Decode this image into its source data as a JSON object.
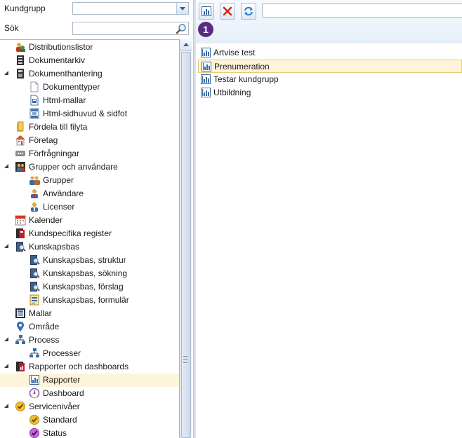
{
  "filters": {
    "kundgrupp_label": "Kundgrupp",
    "kundgrupp_value": "",
    "sok_label": "Sök",
    "sok_value": ""
  },
  "tree": [
    {
      "label": "Distributionslistor",
      "icon": "distribution-list-icon",
      "level": 0,
      "expand": false
    },
    {
      "label": "Dokumentarkiv",
      "icon": "document-archive-icon",
      "level": 0,
      "expand": false
    },
    {
      "label": "Dokumenthantering",
      "icon": "document-management-icon",
      "level": 0,
      "expand": true
    },
    {
      "label": "Dokumenttyper",
      "icon": "document-icon",
      "level": 1,
      "expand": false
    },
    {
      "label": "Html-mallar",
      "icon": "html-template-icon",
      "level": 1,
      "expand": false
    },
    {
      "label": "Html-sidhuvud & sidfot",
      "icon": "html-header-footer-icon",
      "level": 1,
      "expand": false
    },
    {
      "label": "Fördela till filyta",
      "icon": "folder-icon",
      "level": 0,
      "expand": false
    },
    {
      "label": "Företag",
      "icon": "company-icon",
      "level": 0,
      "expand": false
    },
    {
      "label": "Förfrågningar",
      "icon": "request-icon",
      "level": 0,
      "expand": false
    },
    {
      "label": "Grupper och användare",
      "icon": "groups-users-icon",
      "level": 0,
      "expand": true
    },
    {
      "label": "Grupper",
      "icon": "group-icon",
      "level": 1,
      "expand": false
    },
    {
      "label": "Användare",
      "icon": "user-icon",
      "level": 1,
      "expand": false
    },
    {
      "label": "Licenser",
      "icon": "license-user-icon",
      "level": 1,
      "expand": false
    },
    {
      "label": "Kalender",
      "icon": "calendar-icon",
      "level": 0,
      "expand": false
    },
    {
      "label": "Kundspecifika register",
      "icon": "custom-register-icon",
      "level": 0,
      "expand": false
    },
    {
      "label": "Kunskapsbas",
      "icon": "knowledge-base-icon",
      "level": 0,
      "expand": true
    },
    {
      "label": "Kunskapsbas, struktur",
      "icon": "knowledge-base-icon",
      "level": 1,
      "expand": false
    },
    {
      "label": "Kunskapsbas, sökning",
      "icon": "knowledge-base-icon",
      "level": 1,
      "expand": false
    },
    {
      "label": "Kunskapsbas, förslag",
      "icon": "knowledge-base-icon",
      "level": 1,
      "expand": false
    },
    {
      "label": "Kunskapsbas, formulär",
      "icon": "form-icon",
      "level": 1,
      "expand": false
    },
    {
      "label": "Mallar",
      "icon": "template-icon",
      "level": 0,
      "expand": false
    },
    {
      "label": "Område",
      "icon": "location-pin-icon",
      "level": 0,
      "expand": false
    },
    {
      "label": "Process",
      "icon": "process-icon",
      "level": 0,
      "expand": true
    },
    {
      "label": "Processer",
      "icon": "process-icon",
      "level": 1,
      "expand": false
    },
    {
      "label": "Rapporter och dashboards",
      "icon": "reports-icon",
      "level": 0,
      "expand": true
    },
    {
      "label": "Rapporter",
      "icon": "report-chart-icon",
      "level": 1,
      "expand": false,
      "selected": true
    },
    {
      "label": "Dashboard",
      "icon": "dashboard-icon",
      "level": 1,
      "expand": false
    },
    {
      "label": "Servicenivåer",
      "icon": "service-level-icon",
      "level": 0,
      "expand": true
    },
    {
      "label": "Standard",
      "icon": "service-level-icon",
      "level": 1,
      "expand": false
    },
    {
      "label": "Status",
      "icon": "status-icon",
      "level": 1,
      "expand": false
    }
  ],
  "toolbar": {
    "buttons": [
      "new-report-icon",
      "delete-icon",
      "refresh-icon"
    ],
    "input_value": ""
  },
  "badge": {
    "number": "1"
  },
  "list": [
    {
      "label": "Artvise test",
      "selected": false
    },
    {
      "label": "Prenumeration",
      "selected": true
    },
    {
      "label": "Testar kundgrupp",
      "selected": false
    },
    {
      "label": "Utbildning",
      "selected": false
    }
  ],
  "colors": {
    "selection": "#fdf4d9",
    "selection_border": "#e8c97a",
    "badge": "#5b2a82",
    "toolbar_bg": "#e6eef7"
  }
}
